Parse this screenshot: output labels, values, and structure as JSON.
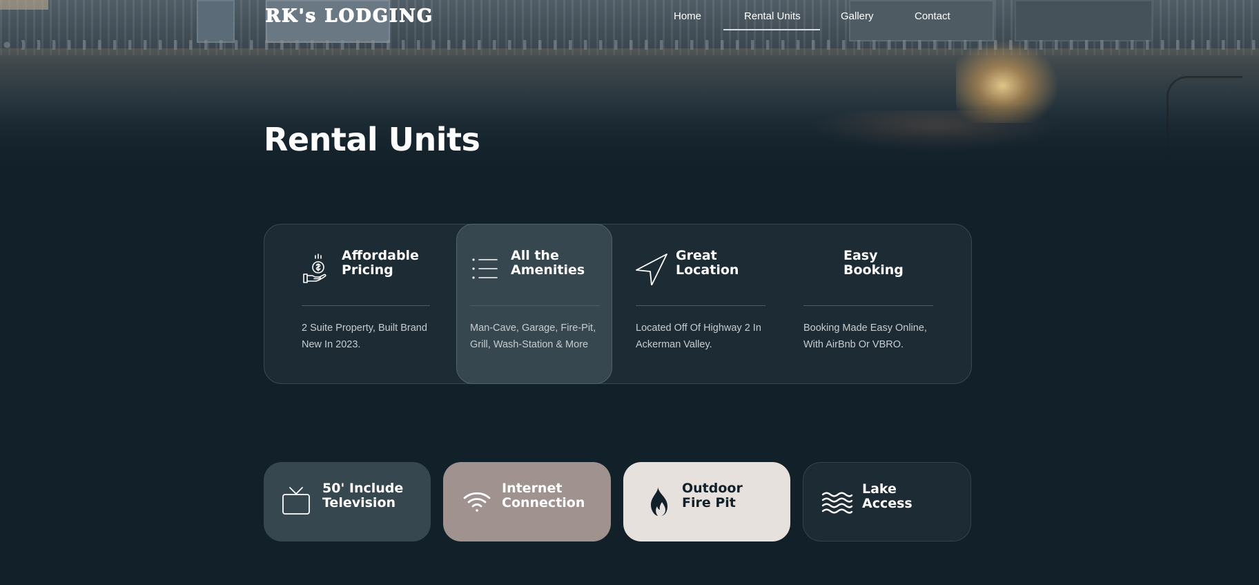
{
  "site": {
    "logo": "RK's LODGING"
  },
  "nav": {
    "items": [
      {
        "label": "Home"
      },
      {
        "label": "Rental Units",
        "active": true
      },
      {
        "label": "Gallery"
      },
      {
        "label": "Contact"
      }
    ]
  },
  "page": {
    "title": "Rental Units"
  },
  "features": [
    {
      "icon": "hand-coin-icon",
      "title_line1": "Affordable",
      "title_line2": "Pricing",
      "desc_line1": "2 Suite Property, Built Brand",
      "desc_line2": "New In 2023."
    },
    {
      "icon": "list-icon",
      "title_line1": "All the",
      "title_line2": "Amenities",
      "desc_line1": "Man-Cave, Garage, Fire-Pit,",
      "desc_line2": "Grill, Wash-Station & More",
      "active": true
    },
    {
      "icon": "navigation-arrow-icon",
      "title_line1": "Great",
      "title_line2": "Location",
      "desc_line1": "Located Off Of Highway 2 In",
      "desc_line2": "Ackerman Valley."
    },
    {
      "icon": "",
      "title_line1": "Easy",
      "title_line2": "Booking",
      "desc_line1": "Booking Made Easy Online,",
      "desc_line2": "With AirBnb Or VBRO."
    }
  ],
  "amenities": [
    {
      "icon": "tv-icon",
      "line1": "50' Include",
      "line2": "Television",
      "bg": "#37474f",
      "color": "#ffffff"
    },
    {
      "icon": "wifi-icon",
      "line1": "Internet",
      "line2": "Connection",
      "bg": "#a0928f",
      "color": "#ffffff"
    },
    {
      "icon": "flame-icon",
      "line1": "Outdoor",
      "line2": "Fire Pit",
      "bg": "#e6e1dc",
      "color": "#12202a"
    },
    {
      "icon": "waves-icon",
      "line1": "Lake",
      "line2": "Access",
      "bg": "#1d2b34",
      "color": "#ffffff"
    }
  ],
  "colors": {
    "page_bg": "#12202a",
    "panel_bg": "#1d2b34",
    "active_card": "#37474f"
  }
}
